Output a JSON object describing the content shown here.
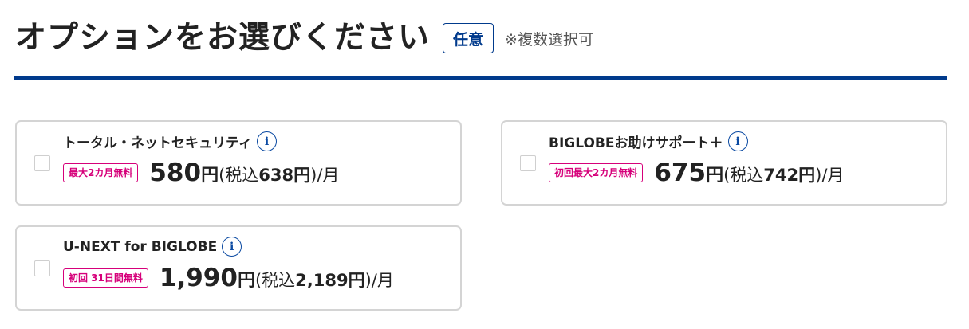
{
  "header": {
    "title": "オプションをお選びください",
    "badge": "任意",
    "note": "※複数選択可"
  },
  "colors": {
    "accent": "#003a8c",
    "campaign": "#d6007a",
    "card_border": "#d4d4d4"
  },
  "options": [
    {
      "name": "トータル・ネットセキュリティ",
      "campaign": "最大2カ月無料",
      "price": "580",
      "yen": "円",
      "tax_open": "(税込",
      "tax_price": "638円",
      "tax_close": ")/月",
      "checked": false,
      "info_icon": "info-icon"
    },
    {
      "name": "BIGLOBEお助けサポート＋",
      "campaign": "初回最大2カ月無料",
      "price": "675",
      "yen": "円",
      "tax_open": "(税込",
      "tax_price": "742円",
      "tax_close": ")/月",
      "checked": false,
      "info_icon": "info-icon"
    },
    {
      "name": "U-NEXT for BIGLOBE",
      "campaign": "初回 31日間無料",
      "price": "1,990",
      "yen": "円",
      "tax_open": "(税込",
      "tax_price": "2,189円",
      "tax_close": ")/月",
      "checked": false,
      "info_icon": "info-icon"
    }
  ]
}
